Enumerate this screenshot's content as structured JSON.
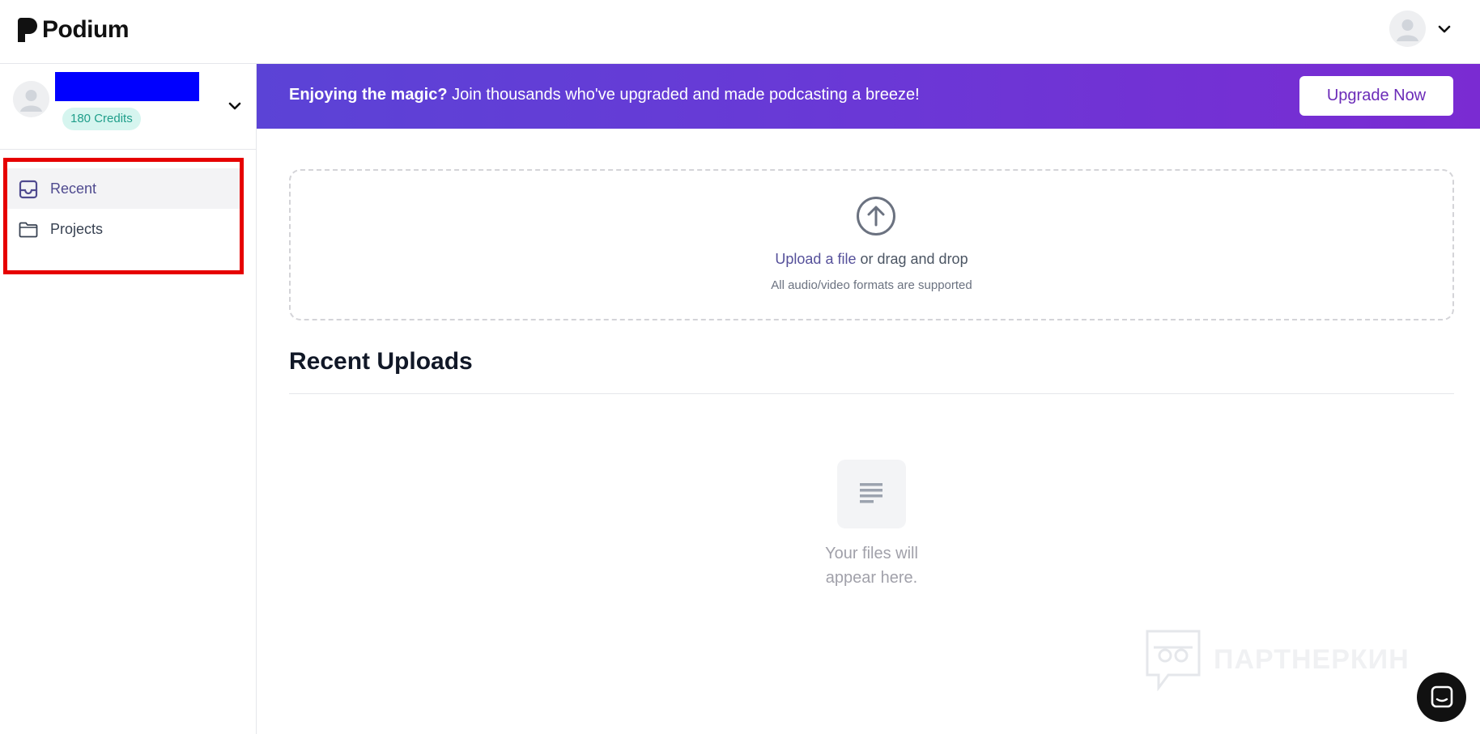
{
  "app": {
    "name": "Podium"
  },
  "header": {
    "avatar_icon": "user-avatar-icon",
    "menu_icon": "chevron-down-icon"
  },
  "sidebar": {
    "account": {
      "credits": "180 Credits",
      "name_redacted_color": "#0000ff"
    },
    "items": [
      {
        "label": "Recent",
        "icon": "inbox-icon",
        "active": true
      },
      {
        "label": "Projects",
        "icon": "folder-icon",
        "active": false
      }
    ]
  },
  "banner": {
    "bold_text": "Enjoying the magic?",
    "text": " Join thousands who've upgraded and made podcasting a breeze!",
    "button_label": "Upgrade Now"
  },
  "upload": {
    "link_text": "Upload a file",
    "rest_text": " or drag and drop",
    "subtext": "All audio/video formats are supported"
  },
  "recent": {
    "title": "Recent Uploads",
    "empty_line1": "Your files will",
    "empty_line2": "appear here."
  },
  "watermark": {
    "text": "ПАРТНЕРКИН"
  },
  "colors": {
    "banner_start": "#5b43d6",
    "banner_end": "#7a2bd2",
    "accent": "#55509a",
    "credits_bg": "#d6f5ef",
    "credits_text": "#1f9e8a",
    "highlight_border": "#e60000"
  }
}
